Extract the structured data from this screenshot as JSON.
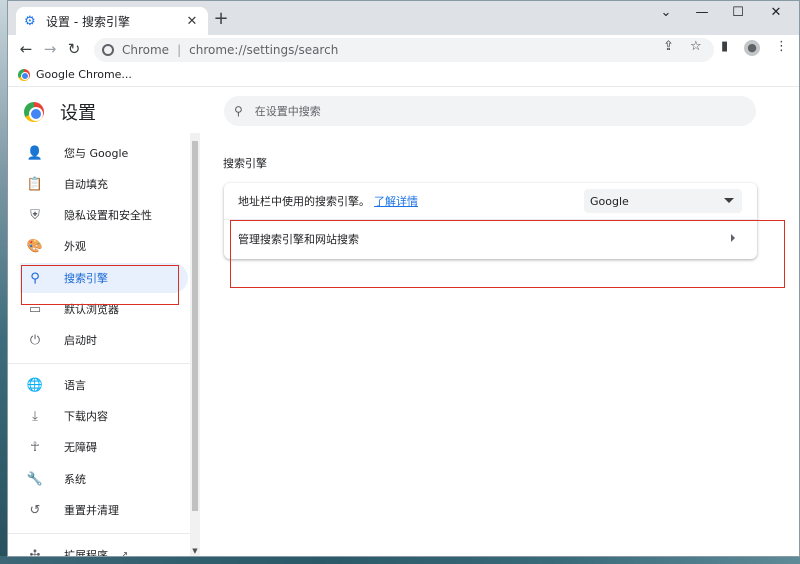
{
  "tab": {
    "title": "设置 - 搜索引擎",
    "close_glyph": "✕"
  },
  "window_controls": {
    "chevron": "⌄",
    "minimize": "—",
    "maximize": "☐",
    "close": "✕"
  },
  "toolbar": {
    "back": "←",
    "forward": "→",
    "reload": "↻",
    "chrome_label": "Chrome",
    "url": "chrome://settings/search"
  },
  "bookmarks": [
    {
      "label": "Google Chrome..."
    }
  ],
  "settings": {
    "title": "设置",
    "search_placeholder": "在设置中搜索",
    "section_title": "搜索引擎",
    "nav": [
      {
        "label": "您与 Google",
        "icon": "person-icon"
      },
      {
        "label": "自动填充",
        "icon": "clipboard-icon"
      },
      {
        "label": "隐私设置和安全性",
        "icon": "shield-icon"
      },
      {
        "label": "外观",
        "icon": "palette-icon"
      },
      {
        "label": "搜索引擎",
        "icon": "search-icon",
        "active": true
      },
      {
        "label": "默认浏览器",
        "icon": "browser-icon"
      },
      {
        "label": "启动时",
        "icon": "power-icon"
      },
      {
        "label": "语言",
        "icon": "globe-icon"
      },
      {
        "label": "下载内容",
        "icon": "download-icon"
      },
      {
        "label": "无障碍",
        "icon": "accessibility-icon"
      },
      {
        "label": "系统",
        "icon": "wrench-icon"
      },
      {
        "label": "重置并清理",
        "icon": "restore-icon"
      },
      {
        "label": "扩展程序",
        "icon": "puzzle-icon"
      }
    ],
    "engine_row": {
      "label": "地址栏中使用的搜索引擎。",
      "link": "了解详情",
      "selected": "Google"
    },
    "manage_row": {
      "label": "管理搜索引擎和网站搜索"
    }
  },
  "colors": {
    "accent": "#1a73e8",
    "active_bg": "#e8f0fe",
    "annotation_red": "#d93025"
  }
}
